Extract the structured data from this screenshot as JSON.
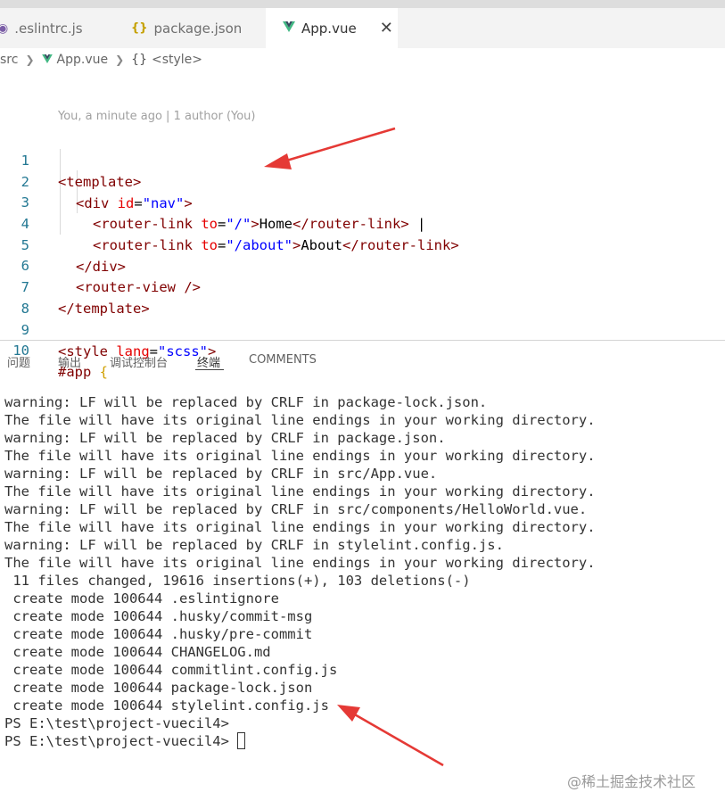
{
  "tabs": [
    {
      "label": ".eslintrc.js",
      "icon": "eslint-icon"
    },
    {
      "label": "package.json",
      "icon": "json-braces-icon"
    },
    {
      "label": "App.vue",
      "icon": "vue-icon",
      "active": true,
      "close": "✕"
    }
  ],
  "breadcrumb": {
    "items": [
      "src",
      "App.vue",
      "<style>"
    ],
    "style_icon": "{}"
  },
  "blame": "You, a minute ago | 1 author (You)",
  "line_numbers": [
    "1",
    "2",
    "3",
    "4",
    "5",
    "6",
    "7",
    "8",
    "9",
    "10"
  ],
  "code": {
    "l1": {
      "open": "<template>"
    },
    "l2": {
      "tag_open": "<div",
      "attr": "id",
      "eq": "=",
      "val": "\"nav\"",
      "close": ">"
    },
    "l3": {
      "tag_open": "<router-link",
      "attr": "to",
      "eq": "=",
      "val": "\"/\"",
      "close": ">",
      "text": "Home",
      "end": "</router-link>",
      "pipe": " |"
    },
    "l4": {
      "tag_open": "<router-link",
      "attr": "to",
      "eq": "=",
      "val": "\"/about\"",
      "close": ">",
      "text": "About",
      "end": "</router-link>"
    },
    "l5": {
      "close": "</div>"
    },
    "l6": {
      "tag": "<router-view />"
    },
    "l7": {
      "close": "</template>"
    },
    "l9": {
      "tag_open": "<style",
      "attr": "lang",
      "eq": "=",
      "val": "\"scss\"",
      "close": ">"
    },
    "l10": {
      "selector": "#app",
      "brace": "{"
    }
  },
  "panel": {
    "tabs": [
      "问题",
      "输出",
      "调试控制台",
      "终端",
      "COMMENTS"
    ],
    "active": "终端"
  },
  "terminal": [
    "warning: LF will be replaced by CRLF in package-lock.json.",
    "The file will have its original line endings in your working directory.",
    "warning: LF will be replaced by CRLF in package.json.",
    "The file will have its original line endings in your working directory.",
    "warning: LF will be replaced by CRLF in src/App.vue.",
    "The file will have its original line endings in your working directory.",
    "warning: LF will be replaced by CRLF in src/components/HelloWorld.vue.",
    "The file will have its original line endings in your working directory.",
    "warning: LF will be replaced by CRLF in stylelint.config.js.",
    "The file will have its original line endings in your working directory.",
    " 11 files changed, 19616 insertions(+), 103 deletions(-)",
    " create mode 100644 .eslintignore",
    " create mode 100644 .husky/commit-msg",
    " create mode 100644 .husky/pre-commit",
    " create mode 100644 CHANGELOG.md",
    " create mode 100644 commitlint.config.js",
    " create mode 100644 package-lock.json",
    " create mode 100644 stylelint.config.js",
    "PS E:\\test\\project-vuecil4>",
    "PS E:\\test\\project-vuecil4>"
  ],
  "watermark": "@稀土掘金技术社区",
  "colors": {
    "annotation_arrow": "#e53935",
    "vue_green": "#41b883",
    "line_number": "#237893"
  }
}
